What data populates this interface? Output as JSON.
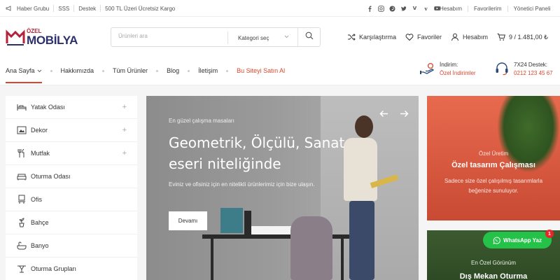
{
  "colors": {
    "accent": "#d9462c",
    "brand_navy": "#2b2f6b",
    "brand_red": "#b5213a",
    "whatsapp": "#25c24a"
  },
  "topbar": {
    "links": [
      {
        "icon": "megaphone-icon",
        "label": "Haber Grubu"
      },
      {
        "label": "SSS"
      },
      {
        "label": "Destek"
      },
      {
        "label": "500 TL Üzeri Ücretsiz Kargo"
      }
    ],
    "social": [
      "facebook-icon",
      "instagram-icon",
      "pinterest-icon",
      "twitter-icon",
      "vk-icon",
      "vimeo-icon",
      "youtube-icon"
    ],
    "account": [
      "Hesabım",
      "Favorilerim",
      "Yönetici Paneli"
    ]
  },
  "header": {
    "logo": {
      "small": "ÖZEL",
      "main": "MOBİLYA"
    },
    "search": {
      "placeholder": "Ürünleri ara",
      "category": "Kategori seç"
    },
    "actions": {
      "compare": "Karşılaştırma",
      "favorites": "Favoriler",
      "account": "Hesabım",
      "cart": "9 / 1.481,00 ₺"
    }
  },
  "nav": {
    "items": [
      "Ana Sayfa",
      "Hakkımızda",
      "Tüm Ürünler",
      "Blog",
      "İletişim"
    ],
    "highlight": "Bu Siteyi Satın Al",
    "discount": {
      "line1": "İndirim:",
      "line2": "Özel İndirimler"
    },
    "support": {
      "line1": "7X24 Destek:",
      "line2": "0212 123 45 67"
    }
  },
  "sidebar": {
    "categories": [
      {
        "label": "Yatak Odası",
        "icon": "bed-icon",
        "expandable": true
      },
      {
        "label": "Dekor",
        "icon": "frame-icon",
        "expandable": true
      },
      {
        "label": "Mutfak",
        "icon": "kitchen-icon",
        "expandable": true
      },
      {
        "label": "Oturma Odası",
        "icon": "sofa-icon",
        "expandable": false
      },
      {
        "label": "Ofis",
        "icon": "desk-icon",
        "expandable": false
      },
      {
        "label": "Bahçe",
        "icon": "plant-icon",
        "expandable": false
      },
      {
        "label": "Banyo",
        "icon": "bath-icon",
        "expandable": false
      },
      {
        "label": "Oturma Grupları",
        "icon": "table-icon",
        "expandable": false
      }
    ]
  },
  "hero": {
    "kicker": "En güzel çalışma masaları",
    "title": "Geometrik, Ölçülü, Sanat eseri niteliğinde",
    "description": "Eviniz ve ofisiniz için en nitelikli ürünlerimiz için bize ulaşın.",
    "button": "Devamı"
  },
  "promo1": {
    "kicker": "Özel Üretim",
    "title": "Özel tasarım Çalışması",
    "description": "Sadece size özel çalışılmış tasarımlarla beğenize sunuluyor."
  },
  "promo2": {
    "kicker": "En Özel Görünüm",
    "title": "Dış Mekan Oturma"
  },
  "whatsapp": {
    "label": "WhatsApp Yaz",
    "badge": "1"
  }
}
